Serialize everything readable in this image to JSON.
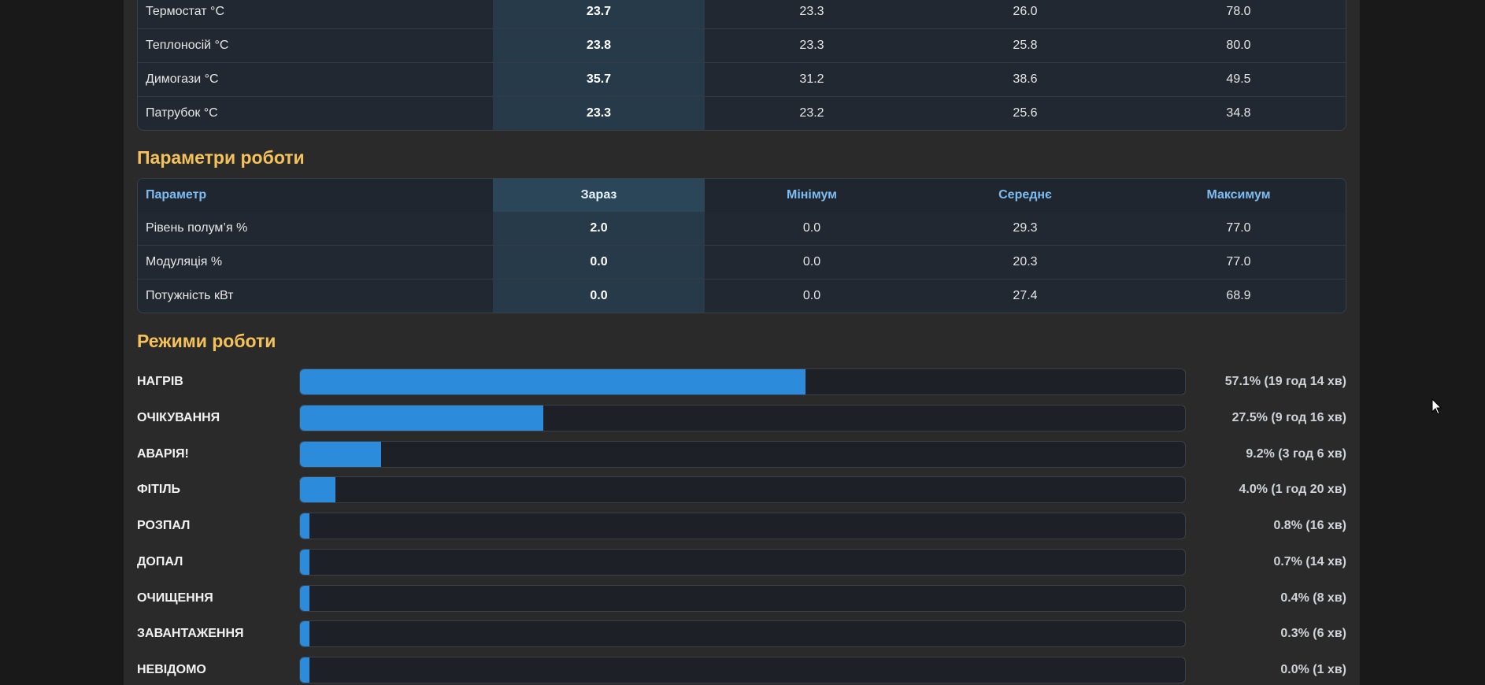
{
  "temperatures": {
    "rows": [
      {
        "name": "Термостат °C",
        "now": "23.7",
        "min": "23.3",
        "avg": "26.0",
        "max": "78.0"
      },
      {
        "name": "Теплоносій °C",
        "now": "23.8",
        "min": "23.3",
        "avg": "25.8",
        "max": "80.0"
      },
      {
        "name": "Димогази °C",
        "now": "35.7",
        "min": "31.2",
        "avg": "38.6",
        "max": "49.5"
      },
      {
        "name": "Патрубок °C",
        "now": "23.3",
        "min": "23.2",
        "avg": "25.6",
        "max": "34.8"
      }
    ]
  },
  "params": {
    "title": "Параметри роботи",
    "headers": {
      "name": "Параметр",
      "now": "Зараз",
      "min": "Мінімум",
      "avg": "Середнє",
      "max": "Максимум"
    },
    "rows": [
      {
        "name": "Рівень полум’я %",
        "now": "2.0",
        "min": "0.0",
        "avg": "29.3",
        "max": "77.0"
      },
      {
        "name": "Модуляція %",
        "now": "0.0",
        "min": "0.0",
        "avg": "20.3",
        "max": "77.0"
      },
      {
        "name": "Потужність кВт",
        "now": "0.0",
        "min": "0.0",
        "avg": "27.4",
        "max": "68.9"
      }
    ]
  },
  "modes": {
    "title": "Режими роботи",
    "items": [
      {
        "label": "НАГРІВ",
        "fraction": 0.571,
        "value": "57.1% (19 год 14 хв)"
      },
      {
        "label": "ОЧІКУВАННЯ",
        "fraction": 0.275,
        "value": "27.5% (9 год 16 хв)"
      },
      {
        "label": "АВАРІЯ!",
        "fraction": 0.092,
        "value": "9.2% (3 год 6 хв)"
      },
      {
        "label": "ФІТІЛЬ",
        "fraction": 0.04,
        "value": "4.0% (1 год 20 хв)"
      },
      {
        "label": "РОЗПАЛ",
        "fraction": 0.008,
        "value": "0.8% (16 хв)"
      },
      {
        "label": "ДОПАЛ",
        "fraction": 0.007,
        "value": "0.7% (14 хв)"
      },
      {
        "label": "ОЧИЩЕННЯ",
        "fraction": 0.004,
        "value": "0.4% (8 хв)"
      },
      {
        "label": "ЗАВАНТАЖЕННЯ",
        "fraction": 0.003,
        "value": "0.3% (6 хв)"
      },
      {
        "label": "НЕВІДОМО",
        "fraction": 0.0,
        "value": "0.0% (1 хв)"
      }
    ]
  },
  "colors": {
    "accent": "#2d8bdb",
    "section_title": "#f5c25a",
    "header_text": "#7dbdf2"
  }
}
